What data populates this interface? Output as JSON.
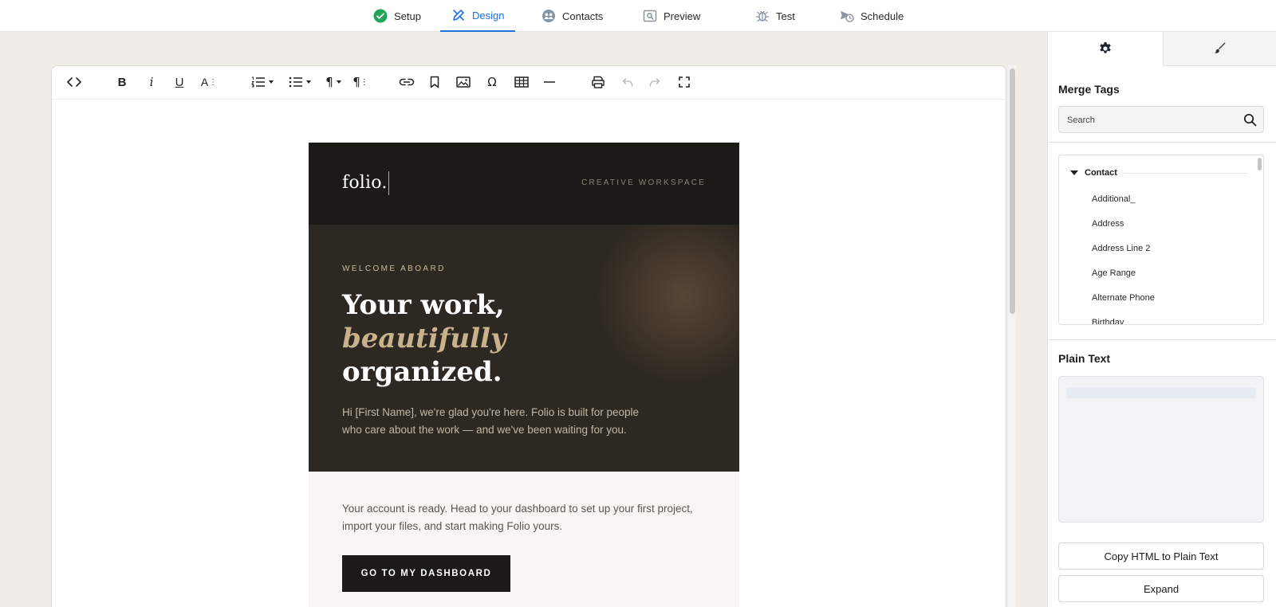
{
  "nav": {
    "tabs": [
      {
        "label": "Setup"
      },
      {
        "label": "Design"
      },
      {
        "label": "Contacts"
      },
      {
        "label": "Preview"
      },
      {
        "label": "Test"
      },
      {
        "label": "Schedule"
      }
    ],
    "active": "Design",
    "colors": {
      "active": "#1a73e8",
      "setup_check": "#22a35a"
    }
  },
  "toolbar": {
    "icons": [
      "code-view-icon",
      "bold-icon",
      "italic-icon",
      "underline-icon",
      "font-size-icon",
      "ordered-list-icon",
      "bullet-list-icon",
      "paragraph-icon",
      "paragraph-format-icon",
      "link-icon",
      "bookmark-icon",
      "image-icon",
      "special-char-icon",
      "table-icon",
      "horizontal-rule-icon",
      "print-icon",
      "undo-icon",
      "redo-icon",
      "fullscreen-icon"
    ],
    "symbols": {
      "bold": "B",
      "italic": "i",
      "underline": "U",
      "font_size": "A",
      "paragraph": "¶",
      "paragraph_format": "¶",
      "special_char": "Ω"
    }
  },
  "email": {
    "brand": "folio.",
    "tagline": "CREATIVE WORKSPACE",
    "hero": {
      "eyebrow": "WELCOME ABOARD",
      "line1": "Your work,",
      "line2": "beautifully",
      "line3": "organized.",
      "copy": "Hi [First Name], we're glad you're here. Folio is built for people who care about the work — and we've been waiting for you."
    },
    "body_copy": "Your account is ready. Head to your dashboard to set up your first project, import your files, and start making Folio yours.",
    "cta_label": "GO TO MY DASHBOARD",
    "colors": {
      "header": "#1c1a16",
      "hero": "#2e2822",
      "accent": "#c8b28c",
      "body": "#f8f6f2"
    }
  },
  "panel": {
    "tabs": [
      "gear-icon",
      "brush-icon"
    ],
    "merge_tags": {
      "title": "Merge Tags",
      "search_placeholder": "Search",
      "group": "Contact",
      "items": [
        "Additional_",
        "Address",
        "Address Line 2",
        "Age Range",
        "Alternate Phone",
        "Birthday"
      ]
    },
    "plain_text": {
      "title": "Plain Text",
      "copy_button": "Copy HTML to Plain Text",
      "expand_button": "Expand"
    }
  }
}
